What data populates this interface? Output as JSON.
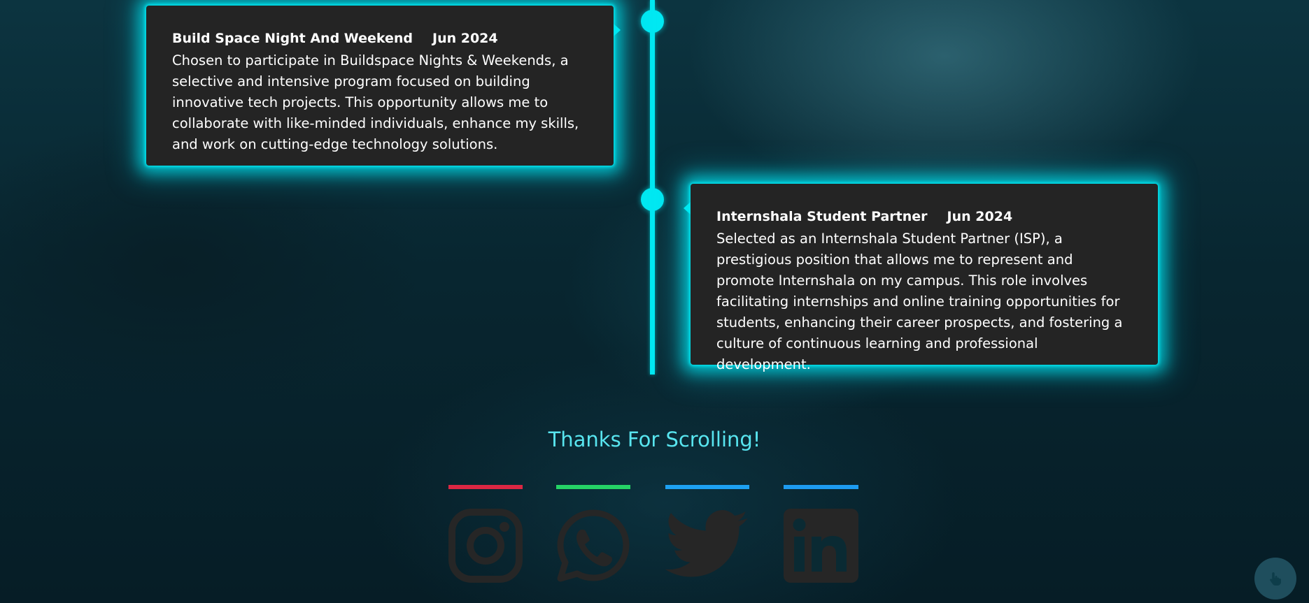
{
  "timeline": {
    "entries": [
      {
        "title": "Build Space Night And Weekend",
        "date": "Jun 2024",
        "description": "Chosen to participate in Buildspace Nights & Weekends, a selective and intensive program focused on building innovative tech projects. This opportunity allows me to collaborate with like-minded individuals, enhance my skills, and work on cutting-edge technology solutions."
      },
      {
        "title": "Internshala Student Partner",
        "date": "Jun 2024",
        "description": "Selected as an Internshala Student Partner (ISP), a prestigious position that allows me to represent and promote Internshala on my campus. This role involves facilitating internships and online training opportunities for students, enhancing their career prospects, and fostering a culture of continuous learning and professional development."
      }
    ]
  },
  "footer": {
    "thanks": "Thanks For Scrolling!"
  },
  "social": [
    {
      "icon": "instagram-icon",
      "accent": "#dc2743"
    },
    {
      "icon": "whatsapp-icon",
      "accent": "#25d366"
    },
    {
      "icon": "twitter-icon",
      "accent": "#1da1f2"
    },
    {
      "icon": "linkedin-icon",
      "accent": "#1d9bf0"
    }
  ],
  "colors": {
    "accent": "#00e8f2",
    "card_bg": "#242424",
    "thanks_text": "#58e5ef",
    "icon_fill": "#262626"
  },
  "fab": {
    "icon": "pointer-hand-icon"
  }
}
